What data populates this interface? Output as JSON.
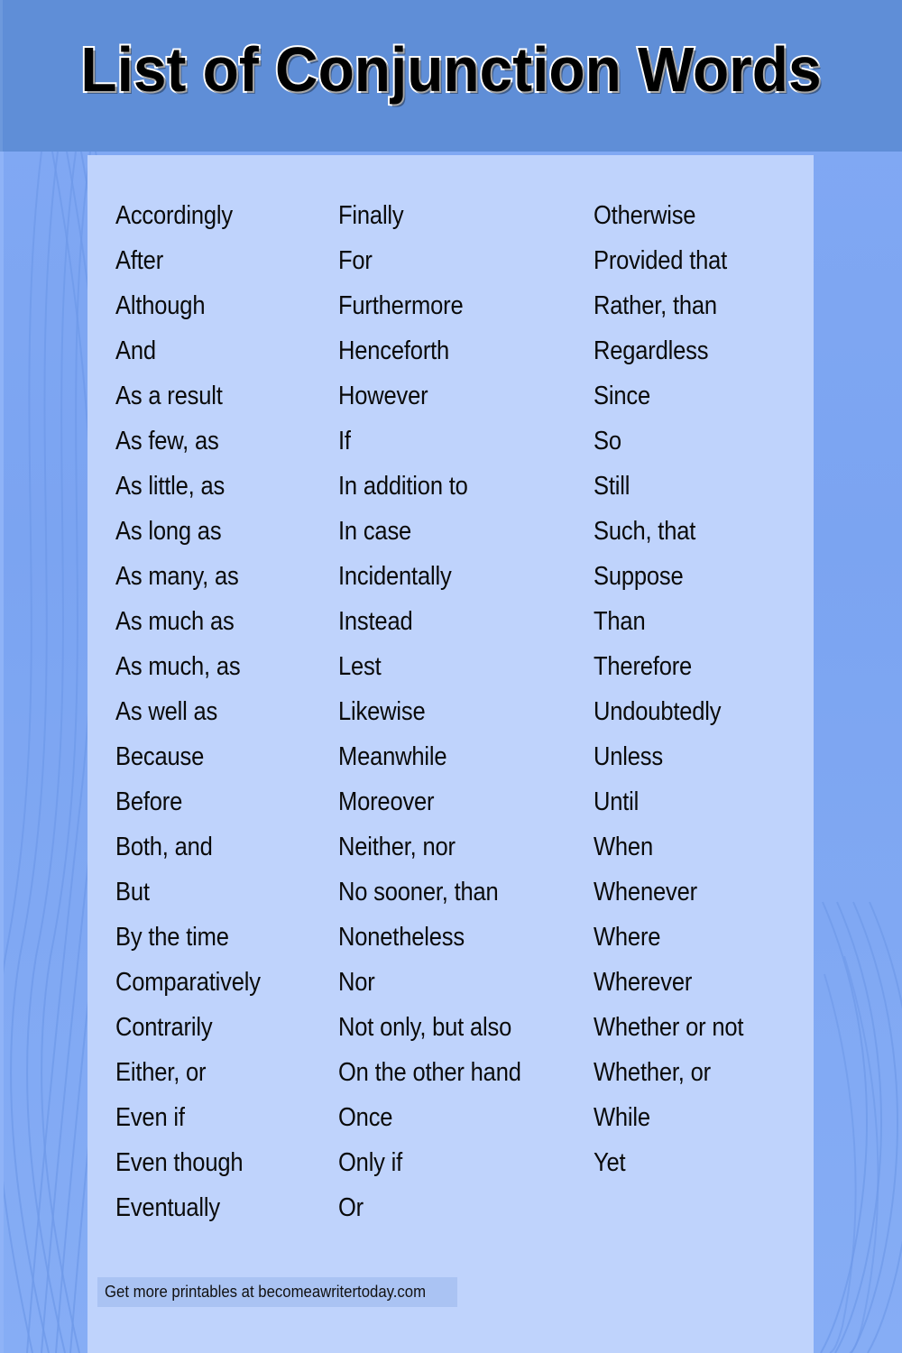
{
  "header": {
    "title": "List of Conjunction Words",
    "background_color": "#5f8ed7",
    "title_color": "#000000",
    "title_outline_color": "#ffffff"
  },
  "page": {
    "background_color": "#7ca6f2",
    "card_background_color": "#bfd3fc"
  },
  "columns": [
    {
      "index": 0,
      "words": [
        "Accordingly",
        "After",
        "Although",
        "And",
        "As a result",
        "As few, as",
        "As little, as",
        "As long as",
        "As many, as",
        "As much as",
        "As much, as",
        "As well as",
        "Because",
        "Before",
        "Both, and",
        "But",
        "By the time",
        "Comparatively",
        "Contrarily",
        "Either, or",
        "Even if",
        "Even though",
        "Eventually"
      ]
    },
    {
      "index": 1,
      "words": [
        "Finally",
        "For",
        "Furthermore",
        "Henceforth",
        "However",
        "If",
        "In addition to",
        "In case",
        "Incidentally",
        "Instead",
        "Lest",
        "Likewise",
        "Meanwhile",
        "Moreover",
        "Neither, nor",
        "No sooner, than",
        "Nonetheless",
        "Nor",
        "Not only, but also",
        "On the other hand",
        "Once",
        "Only if",
        "Or"
      ]
    },
    {
      "index": 2,
      "words": [
        "Otherwise",
        "Provided that",
        "Rather, than",
        "Regardless",
        "Since",
        "So",
        "Still",
        "Such, that",
        "Suppose",
        "Than",
        "Therefore",
        "Undoubtedly",
        "Unless",
        "Until",
        "When",
        "Whenever",
        "Where",
        "Wherever",
        "Whether or not",
        "Whether, or",
        "While",
        "Yet"
      ]
    }
  ],
  "footer": {
    "text": "Get more printables at becomeawritertoday.com",
    "highlight_color": "#aac3f3"
  }
}
